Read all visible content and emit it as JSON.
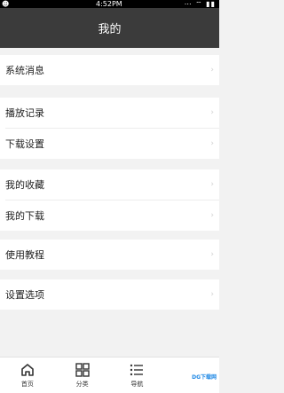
{
  "status_bar": {
    "time": "4:52PM",
    "left_icon": "android-icon",
    "right_icons": "⋯ ⌔ ▮▮"
  },
  "header": {
    "title": "我的"
  },
  "menu": {
    "section1": [
      {
        "label": "系统消息"
      }
    ],
    "section2": [
      {
        "label": "播放记录"
      },
      {
        "label": "下载设置"
      }
    ],
    "section3": [
      {
        "label": "我的收藏"
      },
      {
        "label": "我的下载"
      }
    ],
    "section4": [
      {
        "label": "使用教程"
      }
    ],
    "section5": [
      {
        "label": "设置选项"
      }
    ]
  },
  "chevron": "›",
  "bottom_nav": {
    "items": [
      {
        "label": "首页",
        "icon": "home-icon"
      },
      {
        "label": "分类",
        "icon": "grid-icon"
      },
      {
        "label": "导航",
        "icon": "list-icon"
      }
    ],
    "watermark": "DG下载网"
  }
}
